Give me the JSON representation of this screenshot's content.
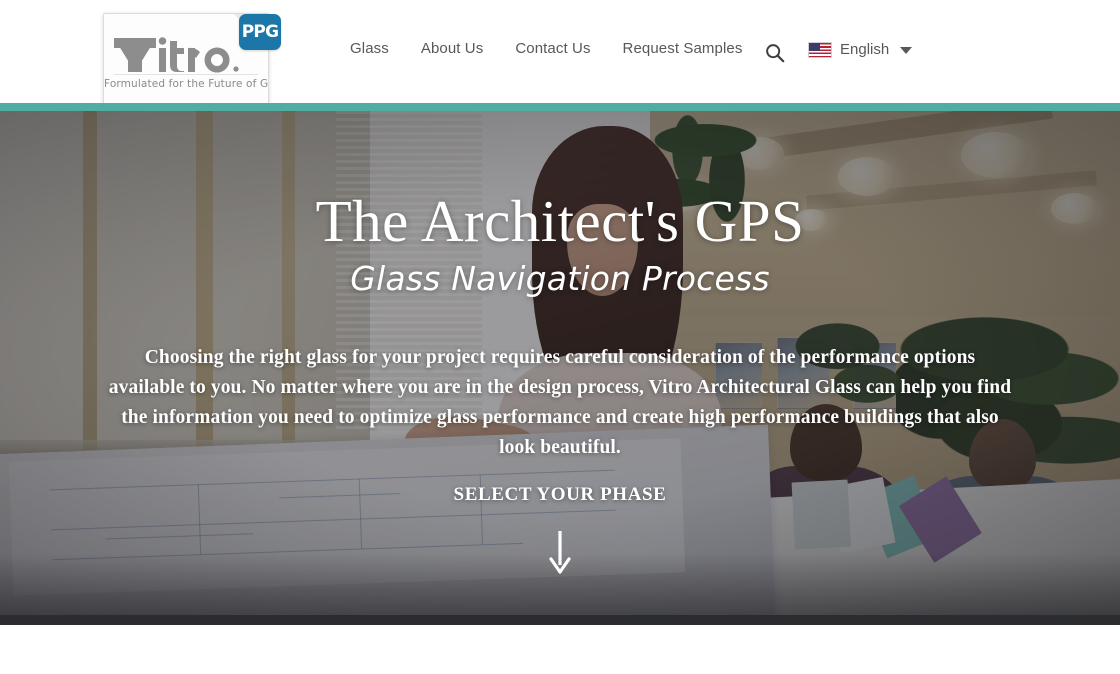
{
  "header": {
    "logo": {
      "wordmark": "Vitro",
      "tagline": "Formulated for the Future of Glass",
      "badge": "PPG",
      "badge_color": "#1c76a8"
    },
    "nav": [
      {
        "label": "Glass"
      },
      {
        "label": "About Us"
      },
      {
        "label": "Contact Us"
      },
      {
        "label": "Request Samples"
      }
    ],
    "search_icon": "search-icon",
    "language": {
      "label": "English",
      "flag": "us-flag-icon",
      "caret": "chevron-down-icon"
    },
    "accent_color": "#50ada3",
    "background_color": "#ffffff"
  },
  "hero": {
    "title": "The Architect's GPS",
    "subtitle": "Glass Navigation Process",
    "body": "Choosing the right glass for your project requires careful consideration of the performance options available to you. No matter where you are in the design process, Vitro Architectural Glass can help you find the information you need to optimize glass performance and create high performance buildings that also look beautiful.",
    "cta_label": "SELECT YOUR PHASE",
    "scroll_icon": "arrow-down-icon",
    "text_color": "#ffffff",
    "overlay_color": "rgba(38,34,40,0.46)"
  }
}
